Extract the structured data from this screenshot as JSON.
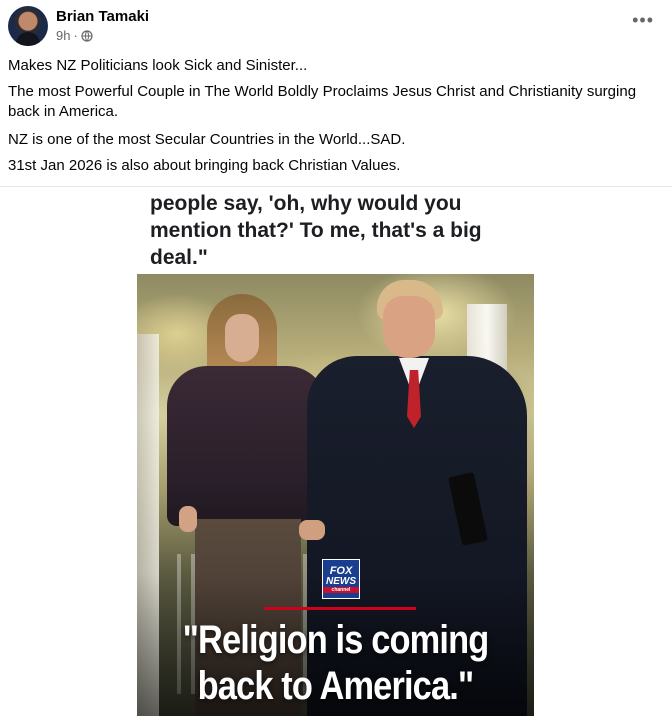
{
  "post": {
    "author": "Brian Tamaki",
    "time": "9h",
    "dot": "·",
    "more": "•••",
    "text": [
      "Makes NZ Politicians look Sick and Sinister...",
      "The most Powerful Couple in The World Boldly Proclaims Jesus Christ and Christianity surging back in America.",
      "NZ is one of the most Secular Countries in the World...SAD.",
      "31st Jan 2026 is also about bringing back Christian Values."
    ]
  },
  "image": {
    "quote": "people say, 'oh, why would you mention that?' To me, that's a big deal.\"",
    "logo": {
      "line1": "FOX",
      "line2": "NEWS",
      "line3": "channel"
    },
    "headline_line1": "\"Religion is coming",
    "headline_line2": "back to America.\""
  },
  "icons": {
    "privacy": "globe-icon",
    "options": "more-options-icon"
  }
}
